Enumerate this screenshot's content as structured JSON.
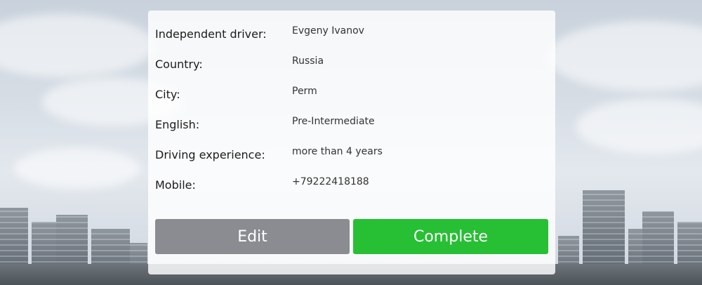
{
  "profile": {
    "rows": [
      {
        "label": "Independent driver:",
        "value": "Evgeny Ivanov"
      },
      {
        "label": "Country:",
        "value": "Russia"
      },
      {
        "label": "City:",
        "value": "Perm"
      },
      {
        "label": "English:",
        "value": "Pre-Intermediate"
      },
      {
        "label": "Driving experience:",
        "value": "more than 4 years"
      },
      {
        "label": "Mobile:",
        "value": "+79222418188"
      }
    ]
  },
  "actions": {
    "edit_label": "Edit",
    "complete_label": "Complete"
  },
  "colors": {
    "edit_button": "#8b8c91",
    "complete_button": "#27bf34"
  }
}
